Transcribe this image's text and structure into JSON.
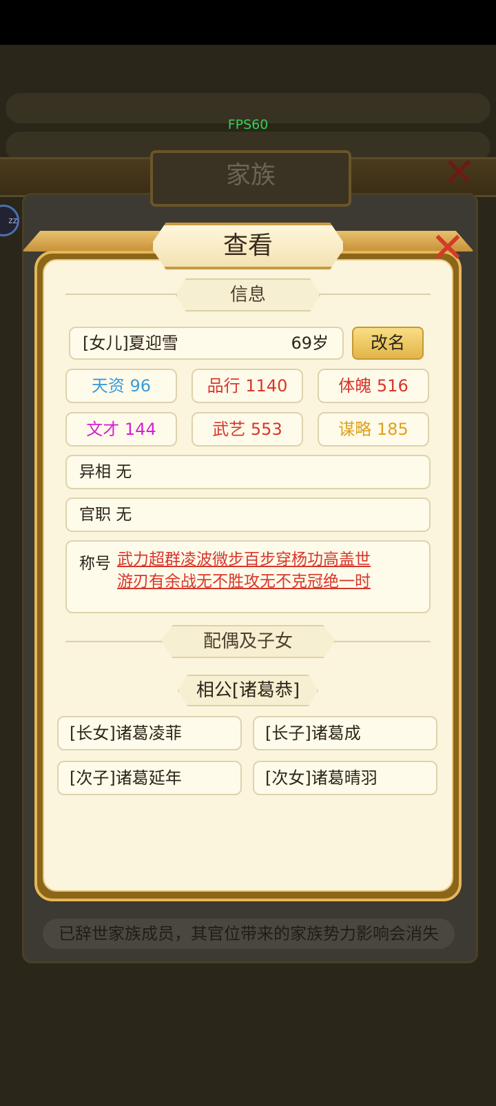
{
  "overlay": {
    "fps": "FPS60",
    "family_title": "家族",
    "family_footer": "已辞世家族成员，其官位带来的家族势力影响会消失"
  },
  "dialog": {
    "title": "查看",
    "info_section": "信息",
    "person_name": "[女儿]夏迎雪",
    "person_age": "69岁",
    "rename_button": "改名",
    "stats": [
      {
        "text": "天资 96",
        "color": "#3b9ad9"
      },
      {
        "text": "品行 1140",
        "color": "#d8352b"
      },
      {
        "text": "体魄 516",
        "color": "#d8352b"
      },
      {
        "text": "文才 144",
        "color": "#d61fd6"
      },
      {
        "text": "武艺 553",
        "color": "#d8352b"
      },
      {
        "text": "谋略 185",
        "color": "#e0a11b"
      }
    ],
    "feature": "异相 无",
    "office": "官职 无",
    "title_label": "称号",
    "title_lines": [
      "武力超群凌波微步百步穿杨功高盖世",
      "游刃有余战无不胜攻无不克冠绝一时"
    ],
    "family_section": "配偶及子女",
    "spouse": "相公[诸葛恭]",
    "children": [
      "[长女]诸葛凌菲",
      "[长子]诸葛成",
      "[次子]诸葛延年",
      "[次女]诸葛晴羽"
    ]
  }
}
